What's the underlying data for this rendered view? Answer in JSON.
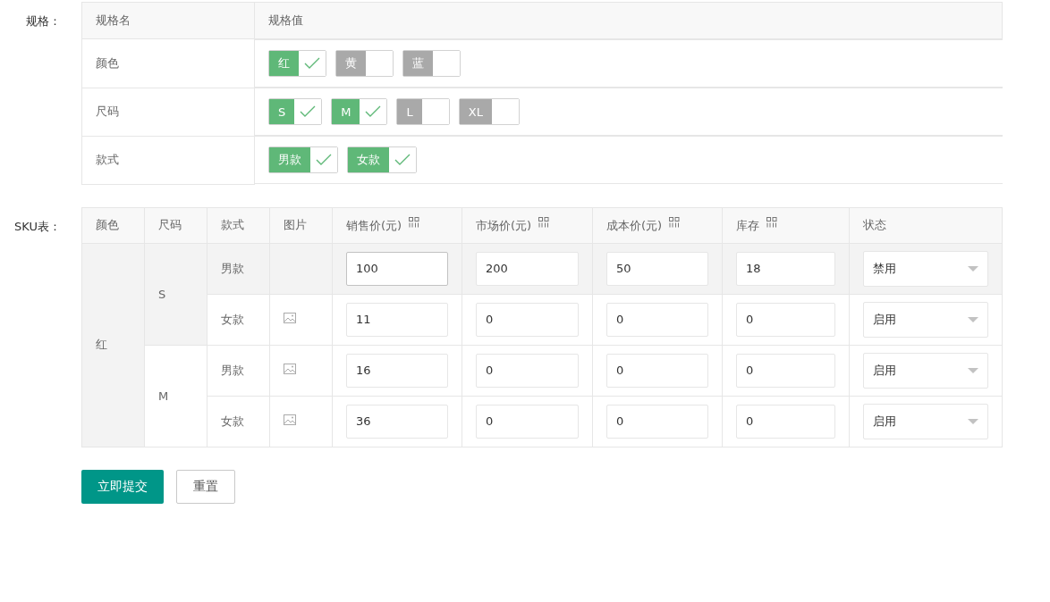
{
  "spec": {
    "label": "规格：",
    "columns": [
      "规格名",
      "规格值"
    ],
    "rows": [
      {
        "name": "颜色",
        "values": [
          {
            "label": "红",
            "selected": true
          },
          {
            "label": "黄",
            "selected": false
          },
          {
            "label": "蓝",
            "selected": false
          }
        ]
      },
      {
        "name": "尺码",
        "values": [
          {
            "label": "S",
            "selected": true
          },
          {
            "label": "M",
            "selected": true
          },
          {
            "label": "L",
            "selected": false
          },
          {
            "label": "XL",
            "selected": false
          }
        ]
      },
      {
        "name": "款式",
        "values": [
          {
            "label": "男款",
            "selected": true
          },
          {
            "label": "女款",
            "selected": true
          }
        ]
      }
    ]
  },
  "sku": {
    "label": "SKU表：",
    "columns": [
      {
        "label": "颜色",
        "batch": false
      },
      {
        "label": "尺码",
        "batch": false
      },
      {
        "label": "款式",
        "batch": false
      },
      {
        "label": "图片",
        "batch": false
      },
      {
        "label": "销售价(元)",
        "batch": true
      },
      {
        "label": "市场价(元)",
        "batch": true
      },
      {
        "label": "成本价(元)",
        "batch": true
      },
      {
        "label": "库存",
        "batch": true
      },
      {
        "label": "状态",
        "batch": false
      }
    ],
    "colors": [
      {
        "name": "红",
        "sizes": [
          {
            "name": "S",
            "variants": [
              {
                "style": "男款",
                "highlighted": true,
                "image": false,
                "fields": [
                  {
                    "value": "100",
                    "focused": true
                  },
                  {
                    "value": "200",
                    "focused": false
                  },
                  {
                    "value": "50",
                    "focused": false
                  },
                  {
                    "value": "18",
                    "focused": false
                  }
                ],
                "status": "禁用"
              },
              {
                "style": "女款",
                "highlighted": false,
                "image": true,
                "fields": [
                  {
                    "value": "11",
                    "focused": false
                  },
                  {
                    "value": "0",
                    "focused": false
                  },
                  {
                    "value": "0",
                    "focused": false
                  },
                  {
                    "value": "0",
                    "focused": false
                  }
                ],
                "status": "启用"
              }
            ]
          },
          {
            "name": "M",
            "variants": [
              {
                "style": "男款",
                "highlighted": false,
                "image": true,
                "fields": [
                  {
                    "value": "16",
                    "focused": false
                  },
                  {
                    "value": "0",
                    "focused": false
                  },
                  {
                    "value": "0",
                    "focused": false
                  },
                  {
                    "value": "0",
                    "focused": false
                  }
                ],
                "status": "启用"
              },
              {
                "style": "女款",
                "highlighted": false,
                "image": true,
                "fields": [
                  {
                    "value": "36",
                    "focused": false
                  },
                  {
                    "value": "0",
                    "focused": false
                  },
                  {
                    "value": "0",
                    "focused": false
                  },
                  {
                    "value": "0",
                    "focused": false
                  }
                ],
                "status": "启用"
              }
            ]
          }
        ]
      }
    ]
  },
  "buttons": [
    {
      "label": "立即提交",
      "kind": "primary"
    },
    {
      "label": "重置",
      "kind": "plain"
    }
  ]
}
